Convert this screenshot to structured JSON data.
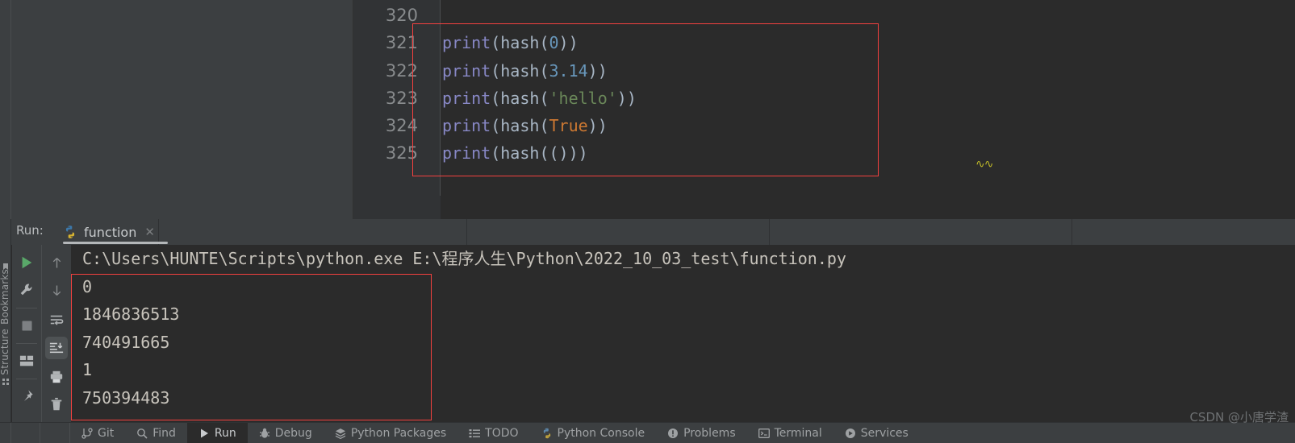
{
  "colors": {
    "bg_editor": "#2b2b2b",
    "bg_panel": "#3c3f41",
    "gutter": "#313335",
    "annotation_red": "#f4413f",
    "text_default": "#a9b7c6",
    "token_function": "#8888c6",
    "token_number": "#6897bb",
    "token_string": "#6a8759",
    "token_keyword": "#cc7832",
    "console_text": "#c8c4bc",
    "accent_green": "#59a869"
  },
  "editor": {
    "gutter_line_numbers": [
      "320",
      "321",
      "322",
      "323",
      "324",
      "325"
    ],
    "lines": [
      {
        "number": "320",
        "tokens": []
      },
      {
        "number": "321",
        "tokens": [
          {
            "t": "print",
            "c": "fn"
          },
          {
            "t": "(",
            "c": "pun"
          },
          {
            "t": "hash",
            "c": "call"
          },
          {
            "t": "(",
            "c": "pun"
          },
          {
            "t": "0",
            "c": "num"
          },
          {
            "t": "))",
            "c": "pun"
          }
        ]
      },
      {
        "number": "322",
        "tokens": [
          {
            "t": "print",
            "c": "fn"
          },
          {
            "t": "(",
            "c": "pun"
          },
          {
            "t": "hash",
            "c": "call"
          },
          {
            "t": "(",
            "c": "pun"
          },
          {
            "t": "3.14",
            "c": "num"
          },
          {
            "t": "))",
            "c": "pun"
          }
        ]
      },
      {
        "number": "323",
        "tokens": [
          {
            "t": "print",
            "c": "fn"
          },
          {
            "t": "(",
            "c": "pun"
          },
          {
            "t": "hash",
            "c": "call"
          },
          {
            "t": "(",
            "c": "pun"
          },
          {
            "t": "'hello'",
            "c": "str"
          },
          {
            "t": "))",
            "c": "pun"
          }
        ]
      },
      {
        "number": "324",
        "tokens": [
          {
            "t": "print",
            "c": "fn"
          },
          {
            "t": "(",
            "c": "pun"
          },
          {
            "t": "hash",
            "c": "call"
          },
          {
            "t": "(",
            "c": "pun"
          },
          {
            "t": "True",
            "c": "kw"
          },
          {
            "t": "))",
            "c": "pun"
          }
        ]
      },
      {
        "number": "325",
        "tokens": [
          {
            "t": "print",
            "c": "fn"
          },
          {
            "t": "(",
            "c": "pun"
          },
          {
            "t": "hash",
            "c": "call"
          },
          {
            "t": "(()",
            "c": "pun"
          },
          {
            "t": "))",
            "c": "pun"
          }
        ]
      }
    ],
    "squiggle_glyph": "∿∿"
  },
  "run_window": {
    "label": "Run:",
    "tab": {
      "icon": "python-icon",
      "title": "function",
      "close_glyph": "✕"
    },
    "left_toolbar": [
      {
        "name": "rerun-button",
        "icon": "play-icon"
      },
      {
        "name": "edit-config-button",
        "icon": "wrench-icon"
      },
      {
        "name": "stop-button",
        "icon": "stop-icon"
      },
      {
        "name": "layout-button",
        "icon": "layout-icon"
      },
      {
        "name": "pin-tab-button",
        "icon": "pin-icon"
      }
    ],
    "console_toolbar": [
      {
        "name": "up-the-stack-button",
        "icon": "arrow-up-icon",
        "selected": false
      },
      {
        "name": "down-the-stack-button",
        "icon": "arrow-down-icon",
        "selected": false
      },
      {
        "name": "soft-wrap-button",
        "icon": "soft-wrap-icon",
        "selected": false
      },
      {
        "name": "scroll-to-end-button",
        "icon": "scroll-end-icon",
        "selected": true
      },
      {
        "name": "print-button",
        "icon": "printer-icon",
        "selected": false
      },
      {
        "name": "clear-all-button",
        "icon": "trash-icon",
        "selected": false
      }
    ]
  },
  "console": {
    "command_line": "C:\\Users\\HUNTE\\Scripts\\python.exe E:\\程序人生\\Python\\2022_10_03_test\\function.py",
    "output_lines": [
      "0",
      "1846836513",
      "740491665",
      "1",
      "750394483"
    ]
  },
  "side_stripes": [
    {
      "label": "Bookmarks",
      "icon": "bookmark-icon"
    },
    {
      "label": "Structure",
      "icon": "structure-icon"
    }
  ],
  "statusbar": {
    "items": [
      {
        "label": "Git",
        "icon": "git-icon",
        "active": false
      },
      {
        "label": "Find",
        "icon": "find-icon",
        "active": false
      },
      {
        "label": "Run",
        "icon": "run-icon",
        "active": true
      },
      {
        "label": "Debug",
        "icon": "debug-icon",
        "active": false
      },
      {
        "label": "Python Packages",
        "icon": "packages-icon",
        "active": false
      },
      {
        "label": "TODO",
        "icon": "todo-icon",
        "active": false
      },
      {
        "label": "Python Console",
        "icon": "python-console-icon",
        "active": false
      },
      {
        "label": "Problems",
        "icon": "problems-icon",
        "active": false
      },
      {
        "label": "Terminal",
        "icon": "terminal-icon",
        "active": false
      },
      {
        "label": "Services",
        "icon": "services-icon",
        "active": false
      }
    ]
  },
  "watermark": {
    "text": "CSDN @小唐学渣"
  }
}
